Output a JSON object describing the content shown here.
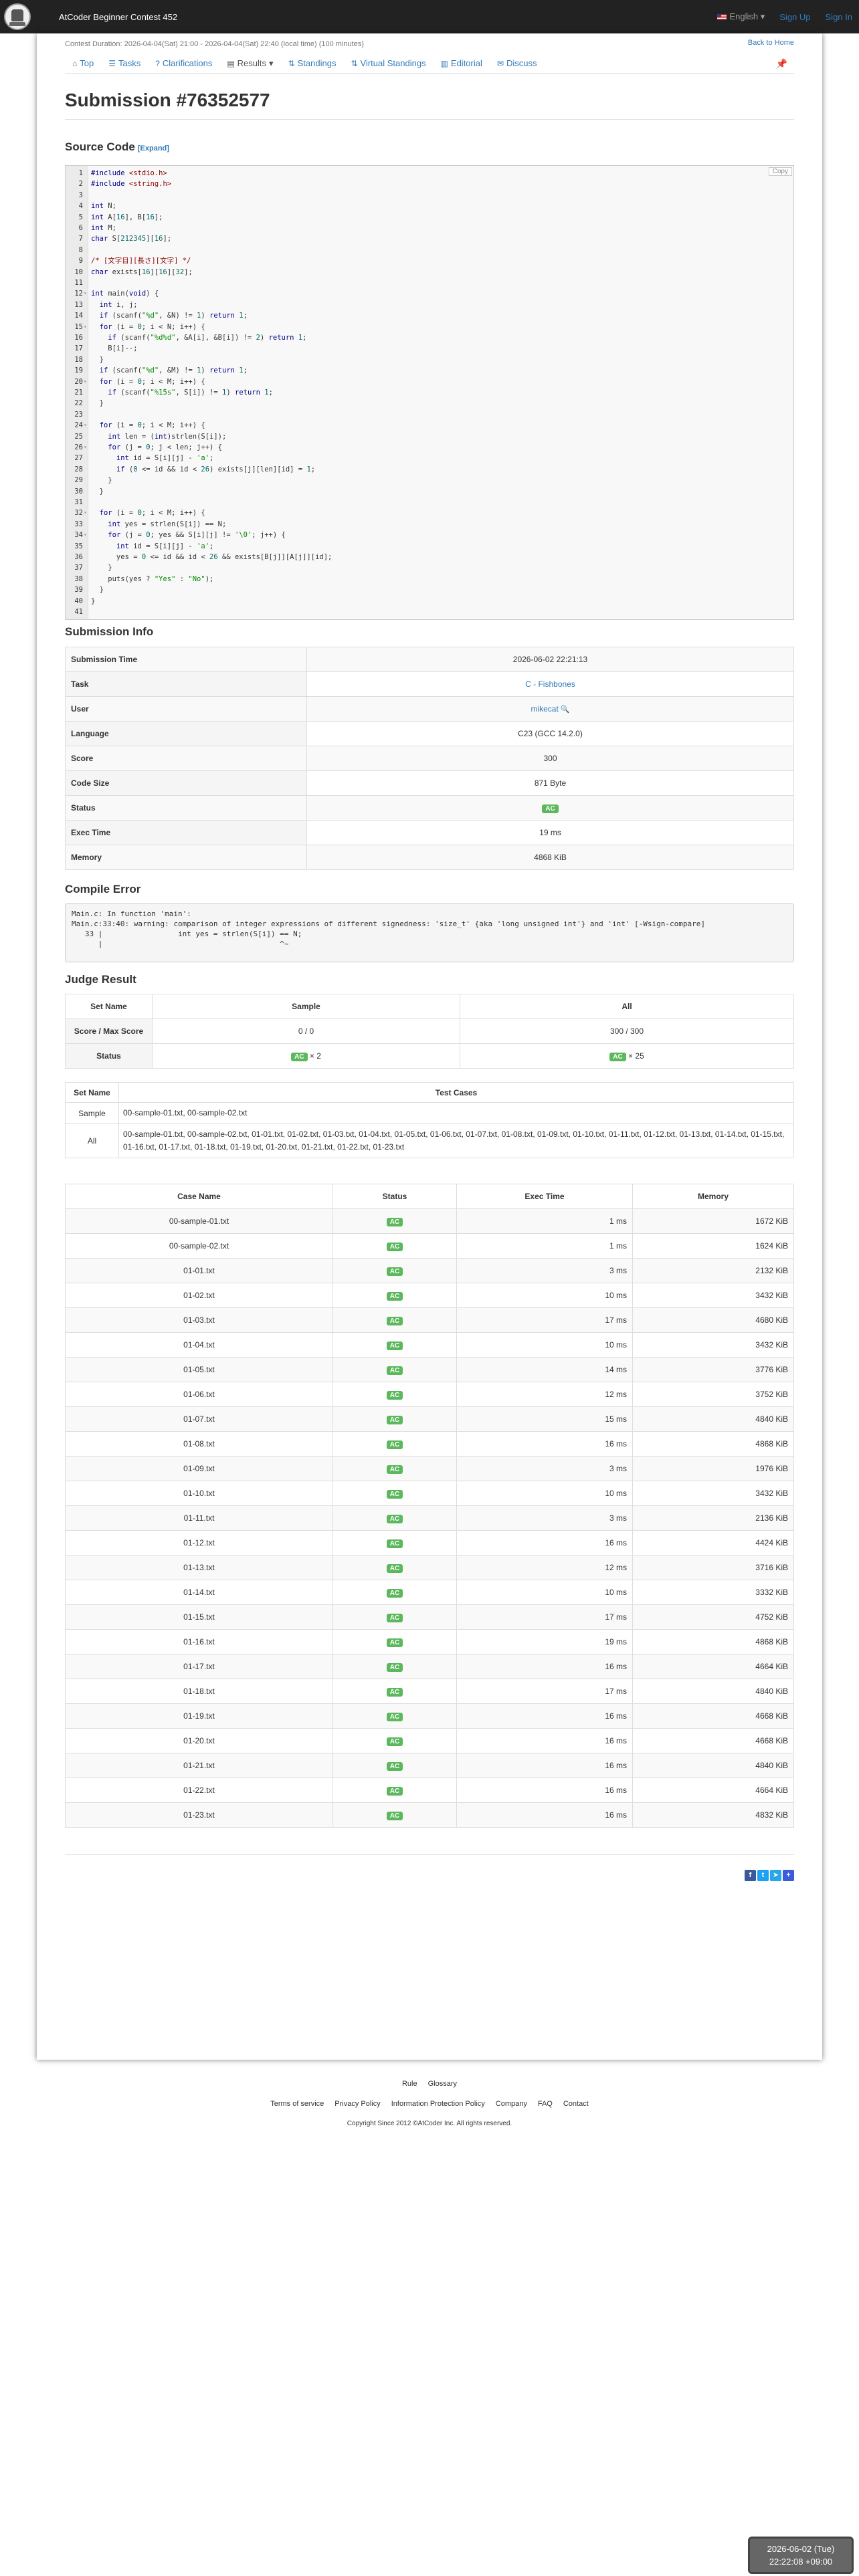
{
  "header": {
    "brand": "AtCoder Beginner Contest 452",
    "lang": "English",
    "signup": "Sign Up",
    "signin": "Sign In"
  },
  "contest": {
    "duration": "Contest Duration: 2026-04-04(Sat) 21:00 - 2026-04-04(Sat) 22:40 (local time) (100 minutes)",
    "back": "Back to Home"
  },
  "tabs": [
    "Top",
    "Tasks",
    "Clarifications",
    "Results",
    "Standings",
    "Virtual Standings",
    "Editorial",
    "Discuss"
  ],
  "title": "Submission #76352577",
  "source": {
    "heading": "Source Code",
    "expand": "[Expand]",
    "copy": "Copy",
    "lines": [
      "#include <stdio.h>",
      "#include <string.h>",
      "",
      "int N;",
      "int A[16], B[16];",
      "int M;",
      "char S[212345][16];",
      "",
      "/* [文字目][長さ][文字] */",
      "char exists[16][16][32];",
      "",
      "int main(void) {",
      "  int i, j;",
      "  if (scanf(\"%d\", &N) != 1) return 1;",
      "  for (i = 0; i < N; i++) {",
      "    if (scanf(\"%d%d\", &A[i], &B[i]) != 2) return 1;",
      "    B[i]--;",
      "  }",
      "  if (scanf(\"%d\", &M) != 1) return 1;",
      "  for (i = 0; i < M; i++) {",
      "    if (scanf(\"%15s\", S[i]) != 1) return 1;",
      "  }",
      "",
      "  for (i = 0; i < M; i++) {",
      "    int len = (int)strlen(S[i]);",
      "    for (j = 0; j < len; j++) {",
      "      int id = S[i][j] - 'a';",
      "      if (0 <= id && id < 26) exists[j][len][id] = 1;",
      "    }",
      "  }",
      "",
      "  for (i = 0; i < M; i++) {",
      "    int yes = strlen(S[i]) == N;",
      "    for (j = 0; yes && S[i][j] != '\\0'; j++) {",
      "      int id = S[i][j] - 'a';",
      "      yes = 0 <= id && id < 26 && exists[B[j]][A[j]][id];",
      "    }",
      "    puts(yes ? \"Yes\" : \"No\");",
      "  }",
      "}",
      ""
    ],
    "folds": [
      12,
      15,
      20,
      24,
      26,
      32,
      34
    ]
  },
  "info": {
    "heading": "Submission Info",
    "rows": [
      {
        "k": "Submission Time",
        "v": "2026-06-02 22:21:13"
      },
      {
        "k": "Task",
        "v": "C - Fishbones"
      },
      {
        "k": "User",
        "v": "mikecat"
      },
      {
        "k": "Language",
        "v": "C23 (GCC 14.2.0)"
      },
      {
        "k": "Score",
        "v": "300"
      },
      {
        "k": "Code Size",
        "v": "871 Byte"
      },
      {
        "k": "Status",
        "v": "AC"
      },
      {
        "k": "Exec Time",
        "v": "19 ms"
      },
      {
        "k": "Memory",
        "v": "4868 KiB"
      }
    ]
  },
  "compile": {
    "heading": "Compile Error",
    "text": "Main.c: In function 'main':\nMain.c:33:40: warning: comparison of integer expressions of different signedness: 'size_t' {aka 'long unsigned int'} and 'int' [-Wsign-compare]\n   33 |                 int yes = strlen(S[i]) == N;\n      |                                        ^~"
  },
  "judge": {
    "heading": "Judge Result",
    "h_set": "Set Name",
    "h_sample": "Sample",
    "h_all": "All",
    "score_label": "Score / Max Score",
    "sample_score": "0 / 0",
    "all_score": "300 / 300",
    "status_label": "Status",
    "sample_count": "× 2",
    "all_count": "× 25"
  },
  "sets": {
    "h1": "Set Name",
    "h2": "Test Cases",
    "rows": [
      {
        "k": "Sample",
        "v": "00-sample-01.txt, 00-sample-02.txt"
      },
      {
        "k": "All",
        "v": "00-sample-01.txt, 00-sample-02.txt, 01-01.txt, 01-02.txt, 01-03.txt, 01-04.txt, 01-05.txt, 01-06.txt, 01-07.txt, 01-08.txt, 01-09.txt, 01-10.txt, 01-11.txt, 01-12.txt, 01-13.txt, 01-14.txt, 01-15.txt, 01-16.txt, 01-17.txt, 01-18.txt, 01-19.txt, 01-20.txt, 01-21.txt, 01-22.txt, 01-23.txt"
      }
    ]
  },
  "cases": {
    "headers": [
      "Case Name",
      "Status",
      "Exec Time",
      "Memory"
    ],
    "rows": [
      [
        "00-sample-01.txt",
        "AC",
        "1 ms",
        "1672 KiB"
      ],
      [
        "00-sample-02.txt",
        "AC",
        "1 ms",
        "1624 KiB"
      ],
      [
        "01-01.txt",
        "AC",
        "3 ms",
        "2132 KiB"
      ],
      [
        "01-02.txt",
        "AC",
        "10 ms",
        "3432 KiB"
      ],
      [
        "01-03.txt",
        "AC",
        "17 ms",
        "4680 KiB"
      ],
      [
        "01-04.txt",
        "AC",
        "10 ms",
        "3432 KiB"
      ],
      [
        "01-05.txt",
        "AC",
        "14 ms",
        "3776 KiB"
      ],
      [
        "01-06.txt",
        "AC",
        "12 ms",
        "3752 KiB"
      ],
      [
        "01-07.txt",
        "AC",
        "15 ms",
        "4840 KiB"
      ],
      [
        "01-08.txt",
        "AC",
        "16 ms",
        "4868 KiB"
      ],
      [
        "01-09.txt",
        "AC",
        "3 ms",
        "1976 KiB"
      ],
      [
        "01-10.txt",
        "AC",
        "10 ms",
        "3432 KiB"
      ],
      [
        "01-11.txt",
        "AC",
        "3 ms",
        "2136 KiB"
      ],
      [
        "01-12.txt",
        "AC",
        "16 ms",
        "4424 KiB"
      ],
      [
        "01-13.txt",
        "AC",
        "12 ms",
        "3716 KiB"
      ],
      [
        "01-14.txt",
        "AC",
        "10 ms",
        "3332 KiB"
      ],
      [
        "01-15.txt",
        "AC",
        "17 ms",
        "4752 KiB"
      ],
      [
        "01-16.txt",
        "AC",
        "19 ms",
        "4868 KiB"
      ],
      [
        "01-17.txt",
        "AC",
        "16 ms",
        "4664 KiB"
      ],
      [
        "01-18.txt",
        "AC",
        "17 ms",
        "4840 KiB"
      ],
      [
        "01-19.txt",
        "AC",
        "16 ms",
        "4668 KiB"
      ],
      [
        "01-20.txt",
        "AC",
        "16 ms",
        "4668 KiB"
      ],
      [
        "01-21.txt",
        "AC",
        "16 ms",
        "4840 KiB"
      ],
      [
        "01-22.txt",
        "AC",
        "16 ms",
        "4664 KiB"
      ],
      [
        "01-23.txt",
        "AC",
        "16 ms",
        "4832 KiB"
      ]
    ]
  },
  "footer": {
    "row1": [
      "Rule",
      "Glossary"
    ],
    "row2": [
      "Terms of service",
      "Privacy Policy",
      "Information Protection Policy",
      "Company",
      "FAQ",
      "Contact"
    ],
    "copyright": "Copyright Since 2012 ©AtCoder Inc. All rights reserved."
  },
  "clock": {
    "date": "2026-06-02 (Tue)",
    "time": "22:22:08 +09:00"
  },
  "colors": {
    "accent": "#337ab7",
    "ac_badge": "#5cb85c",
    "navbar": "#222222"
  }
}
